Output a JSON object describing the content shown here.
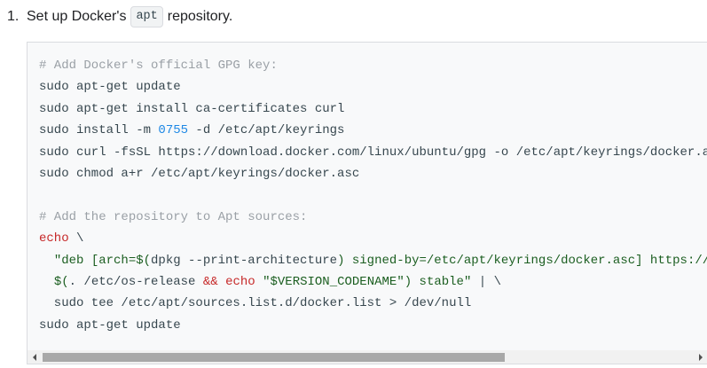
{
  "step": {
    "number": "1.",
    "text_before": "Set up Docker's",
    "inline_code": "apt",
    "text_after": "repository."
  },
  "code": {
    "line1": {
      "comment": "# Add Docker's official GPG key:"
    },
    "line2": {
      "text": "sudo apt-get update"
    },
    "line3": {
      "text": "sudo apt-get install ca-certificates curl"
    },
    "line4": {
      "before": "sudo install -m ",
      "number": "0755",
      "after": " -d /etc/apt/keyrings"
    },
    "line5": {
      "text": "sudo curl -fsSL https://download.docker.com/linux/ubuntu/gpg -o /etc/apt/keyrings/docker.asc"
    },
    "line6": {
      "text": "sudo chmod a+r /etc/apt/keyrings/docker.asc"
    },
    "line7": {
      "text": ""
    },
    "line8": {
      "comment": "# Add the repository to Apt sources:"
    },
    "line9": {
      "keyword": "echo",
      "rest": " \\"
    },
    "line10": {
      "indent": "  ",
      "s1": "\"deb [arch=$(",
      "c1": "dpkg --print-architecture",
      "s2": ") signed-by=/etc/apt/keyrings/docker.asc] https://download.docker.com/linux/ubuntu \\"
    },
    "line11": {
      "indent": "  ",
      "s1": "$(",
      "c1": ". /etc/os-release ",
      "kw1": "&&",
      "c2": " ",
      "kw2": "echo",
      "c3": " ",
      "s2": "\"$VERSION_CODENAME\"",
      "s3": ") stable\"",
      "rest": " | \\"
    },
    "line12": {
      "text": "  sudo tee /etc/apt/sources.list.d/docker.list > /dev/null"
    },
    "line13": {
      "text": "sudo apt-get update"
    }
  },
  "scrollbar": {
    "left_arrow": "arrow-left-icon",
    "right_arrow": "arrow-right-icon",
    "position": 0.0
  },
  "colors": {
    "comment": "#9aa0a6",
    "number": "#1e88e5",
    "keyword": "#c62828",
    "string": "#1b5e20",
    "code_text": "#37474f",
    "code_background": "#f8f9fa"
  }
}
